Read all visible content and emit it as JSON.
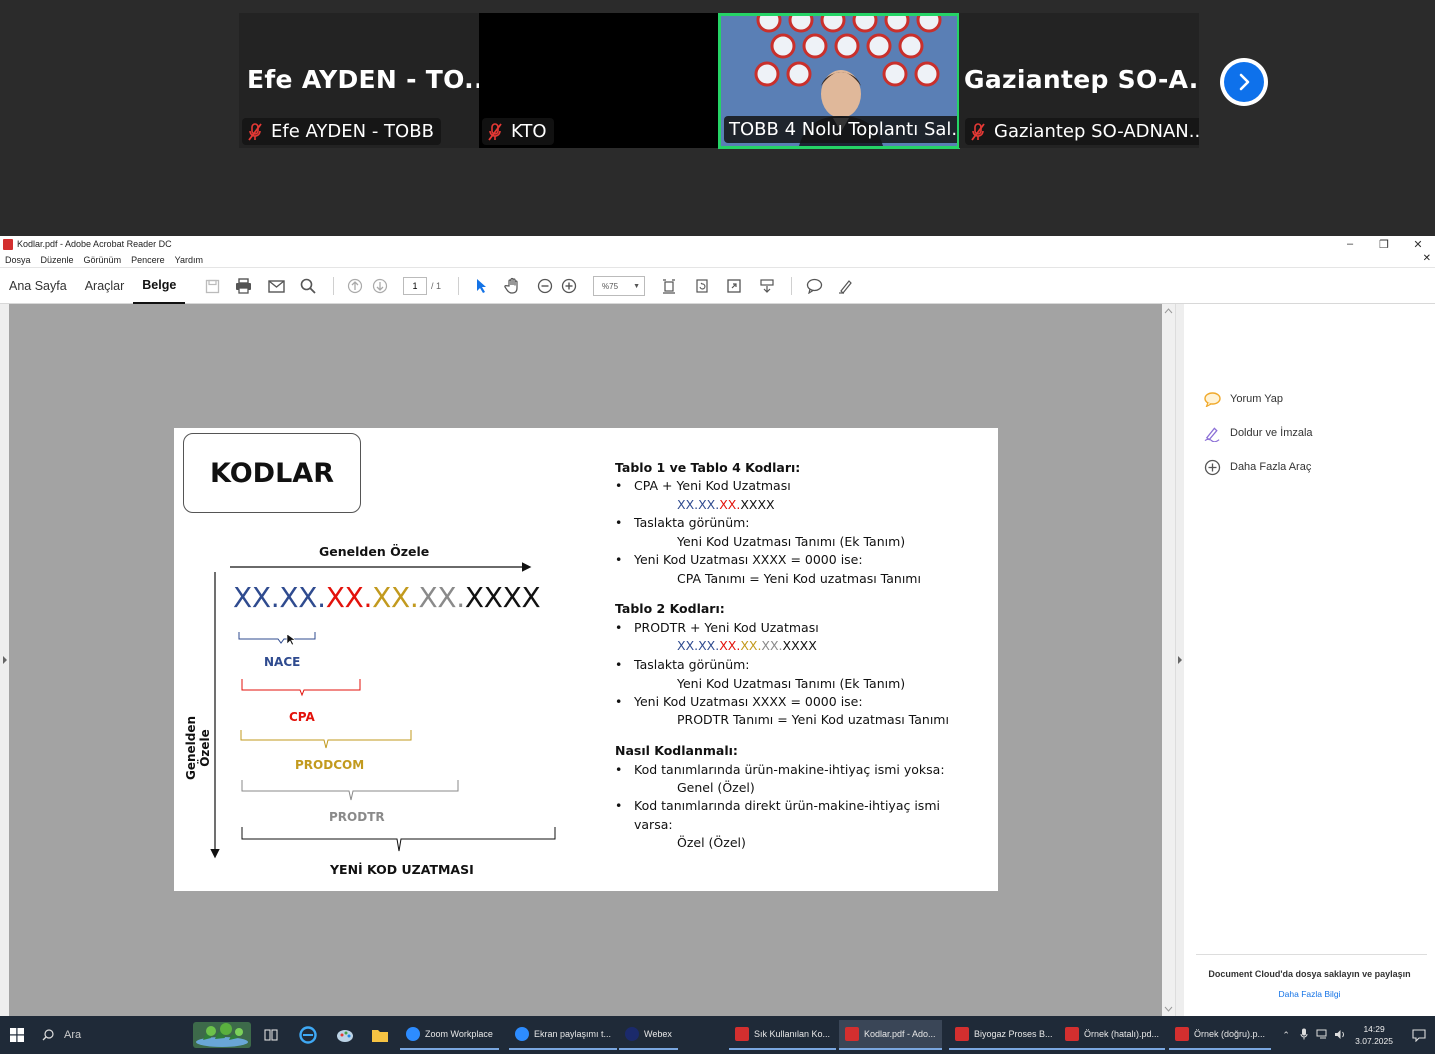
{
  "zoom": {
    "tiles": [
      {
        "big": "Efe AYDEN  - TO...",
        "label": "Efe AYDEN - TOBB",
        "muted": true
      },
      {
        "big": "",
        "label": "KTO",
        "muted": true
      },
      {
        "big": "",
        "label": "TOBB 4 Nolu Toplantı Sal...",
        "muted": false
      },
      {
        "big": "Gaziantep  SO-A...",
        "label": "Gaziantep SO-ADNAN...",
        "muted": true
      }
    ]
  },
  "acrobat": {
    "title": "Kodlar.pdf - Adobe Acrobat Reader DC",
    "menu": [
      "Dosya",
      "Düzenle",
      "Görünüm",
      "Pencere",
      "Yardım"
    ],
    "tabs": [
      "Ana Sayfa",
      "Araçlar",
      "Belge"
    ],
    "page_current": "1",
    "page_total": "/ 1",
    "zoom_level": "%75",
    "right_panel": {
      "items": [
        "Yorum Yap",
        "Doldur ve İmzala",
        "Daha Fazla Araç"
      ],
      "footer_title": "Document Cloud'da dosya saklayın ve paylaşın",
      "footer_link": "Daha Fazla Bilgi"
    }
  },
  "slide": {
    "title": "KODLAR",
    "top_arrow_label": "Genelden Özele",
    "side_arrow_label": "Genelden Özele",
    "code_parts": [
      {
        "t": "XX.",
        "c": "#2f4b8f"
      },
      {
        "t": "XX.",
        "c": "#2f4b8f"
      },
      {
        "t": "XX.",
        "c": "#e3120b"
      },
      {
        "t": "XX.",
        "c": "#c29a1e"
      },
      {
        "t": "XX.",
        "c": "#8a8a8a"
      },
      {
        "t": "XXXX",
        "c": "#111111"
      }
    ],
    "brackets": [
      {
        "label": "NACE",
        "c": "#2f4b8f"
      },
      {
        "label": "CPA",
        "c": "#e3120b"
      },
      {
        "label": "PRODCOM",
        "c": "#c29a1e"
      },
      {
        "label": "PRODTR",
        "c": "#8a8a8a"
      },
      {
        "label": "YENİ KOD UZATMASI",
        "c": "#111111"
      }
    ],
    "sec1": {
      "heading": "Tablo 1 ve Tablo 4 Kodları:",
      "b1": "CPA + Yeni Kod Uzatması",
      "code": [
        {
          "t": "XX.XX.",
          "c": "#2f4b8f"
        },
        {
          "t": "XX.",
          "c": "#e3120b"
        },
        {
          "t": "XXXX",
          "c": "#111111"
        }
      ],
      "b2": "Taslakta görünüm:",
      "b2_sub": "Yeni Kod Uzatması Tanımı (Ek Tanım)",
      "b3": "Yeni Kod Uzatması XXXX = 0000 ise:",
      "b3_sub": "CPA Tanımı = Yeni Kod uzatması Tanımı"
    },
    "sec2": {
      "heading": "Tablo 2 Kodları:",
      "b1": "PRODTR + Yeni Kod Uzatması",
      "code": [
        {
          "t": "XX.XX.",
          "c": "#2f4b8f"
        },
        {
          "t": "XX.",
          "c": "#e3120b"
        },
        {
          "t": "XX.",
          "c": "#c29a1e"
        },
        {
          "t": "XX.",
          "c": "#8a8a8a"
        },
        {
          "t": "XXXX",
          "c": "#111111"
        }
      ],
      "b2": "Taslakta görünüm:",
      "b2_sub": "Yeni Kod Uzatması Tanımı (Ek Tanım)",
      "b3": "Yeni Kod Uzatması XXXX = 0000 ise:",
      "b3_sub": "PRODTR Tanımı = Yeni Kod uzatması Tanımı"
    },
    "sec3": {
      "heading": "Nasıl Kodlanmalı:",
      "b1": "Kod tanımlarında ürün-makine-ihtiyaç ismi yoksa:",
      "b1_sub": "Genel (Özel)",
      "b2_l1": "Kod tanımlarında direkt ürün-makine-ihtiyaç ismi",
      "b2_l2": "varsa:",
      "b2_sub": "Özel (Özel)"
    },
    "bullet": "•"
  },
  "taskbar": {
    "search": "Ara",
    "apps": [
      {
        "label": "Zoom Workplace",
        "color": "#2d8cff"
      },
      {
        "label": "Ekran paylaşımı t...",
        "color": "#2d8cff"
      },
      {
        "label": "Webex",
        "color": "#1b2a6b"
      },
      {
        "label": "Sık Kullanılan Ko...",
        "color": "#d32f2f"
      },
      {
        "label": "Kodlar.pdf - Ado...",
        "color": "#d32f2f"
      },
      {
        "label": "Biyogaz Proses B...",
        "color": "#d32f2f"
      },
      {
        "label": "Örnek (hatalı).pd...",
        "color": "#d32f2f"
      },
      {
        "label": "Örnek (doğru).p...",
        "color": "#d32f2f"
      }
    ],
    "time": "14:29",
    "date": "3.07.2025"
  }
}
